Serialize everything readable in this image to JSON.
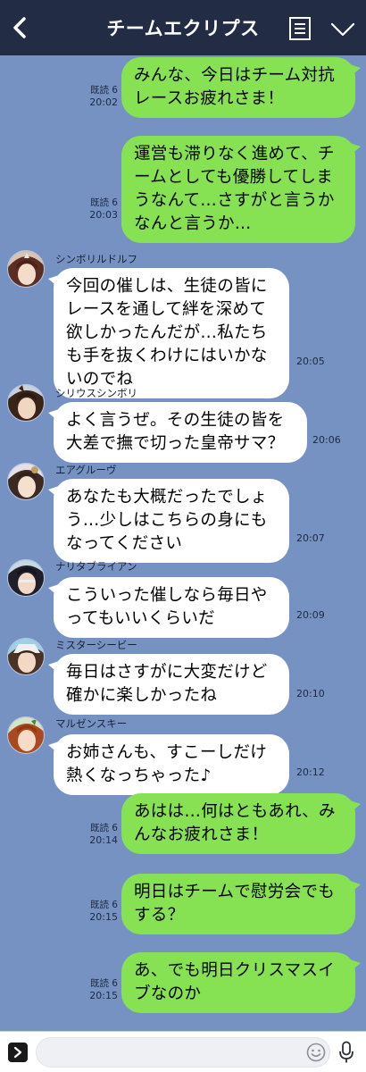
{
  "header": {
    "title": "チームエクリプス"
  },
  "messages": [
    {
      "dir": "out",
      "text": "みんな、今日はチーム対抗\nレースお疲れさま！",
      "read": "既読 6",
      "time": "20:02"
    },
    {
      "dir": "out",
      "text": "運営も滞りなく進めて、チ\nームとしても優勝してしま\nうなんて…さすがと言うか\nなんと言うか…",
      "read": "既読 6",
      "time": "20:03"
    },
    {
      "dir": "in",
      "sender": "シンボリルドルフ",
      "text": "今回の催しは、生徒の皆に\nレースを通して絆を深めて\n欲しかったんだが…私たち\nも手を抜くわけにはいかな\nいのでね",
      "time": "20:05"
    },
    {
      "dir": "in",
      "sender": "シリウスシンボリ",
      "text": "よく言うぜ。その生徒の皆を\n大差で撫で切った皇帝サマ？",
      "time": "20:06"
    },
    {
      "dir": "in",
      "sender": "エアグルーヴ",
      "text": "あなたも大概だったでしょ\nう…少しはこちらの身にも\nなってください",
      "time": "20:07"
    },
    {
      "dir": "in",
      "sender": "ナリタブライアン",
      "text": "こういった催しなら毎日や\nってもいいくらいだ",
      "time": "20:09"
    },
    {
      "dir": "in",
      "sender": "ミスターシービー",
      "text": "毎日はさすがに大変だけど\n確かに楽しかったね",
      "time": "20:10"
    },
    {
      "dir": "in",
      "sender": "マルゼンスキー",
      "text": "お姉さんも、すこーしだけ\n熱くなっちゃった♪",
      "time": "20:12"
    },
    {
      "dir": "out",
      "text": "あはは…何はともあれ、み\nんなお疲れさま！",
      "read": "既読 6",
      "time": "20:14"
    },
    {
      "dir": "out",
      "text": "明日はチームで慰労会でも\nする？",
      "read": "既読 6",
      "time": "20:15"
    },
    {
      "dir": "out",
      "text": "あ、でも明日クリスマスイ\nブなのか",
      "read": "既読 6",
      "time": "20:15"
    }
  ],
  "input": {
    "placeholder": ""
  },
  "colors": {
    "background": "#7592c2",
    "header": "#232c45",
    "outgoing_bubble": "#86e153",
    "incoming_bubble": "#ffffff"
  },
  "icons": {
    "back": "back-arrow-icon",
    "menu": "note-list-icon",
    "collapse": "chevron-down-icon",
    "expand": "expand-arrow-icon",
    "emoji": "smiley-icon",
    "mic": "microphone-icon"
  }
}
